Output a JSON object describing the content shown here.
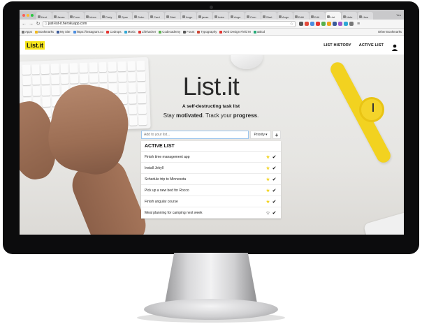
{
  "browser": {
    "tabs": [
      "Kent",
      "Javas",
      "Form",
      "Inbox",
      "Party",
      "Spac",
      "Subn",
      "Card",
      "Start",
      "Angu",
      "javas",
      "Insta",
      "Angu",
      "Com",
      "Start",
      "Angu",
      "Editi",
      "Edit",
      "List",
      "Note",
      "How"
    ],
    "active_tab_index": 18,
    "user_label": "Yeu",
    "url": "just-list-it.herokuapp.com",
    "bookmarks": [
      "Apps",
      "Bookmarks",
      "My Site",
      "https://instagram.co",
      "Codrops",
      "Music",
      "Lifehacker",
      "Codecademy",
      "Fount",
      "Typography",
      "Web Design Field M",
      "uBlod"
    ],
    "other_bookmarks": "Other Bookmarks",
    "colors": {
      "close": "#fc5f57",
      "minimize": "#fdbc2e",
      "maximize": "#28c840"
    }
  },
  "app": {
    "logo": "List.it",
    "nav": {
      "history": "LIST HISTORY",
      "active": "ACTIVE LIST"
    },
    "title": "List.it",
    "subtitle": "A self-destructing task list",
    "tagline": {
      "part1": "Stay ",
      "bold1": "motivated",
      "part2": ". Track your ",
      "bold2": "progress",
      "part3": "."
    },
    "input_placeholder": "Add to your list...",
    "priority_label": "Priority",
    "add_button": "+",
    "list_header": "ACTIVE LIST",
    "items": [
      {
        "text": "Finish time management app",
        "starred": true
      },
      {
        "text": "Install Jekyll",
        "starred": true
      },
      {
        "text": "Schedule trip to Minnesota",
        "starred": true
      },
      {
        "text": "Pick up a new bed for Rocco",
        "starred": true
      },
      {
        "text": "Finish angular course",
        "starred": true
      },
      {
        "text": "Meal planning for camping next week",
        "starred": false
      }
    ],
    "colors": {
      "accent_yellow": "#f6e51b",
      "star_filled": "#f2d31b",
      "input_focus": "#9cc6ee"
    }
  }
}
